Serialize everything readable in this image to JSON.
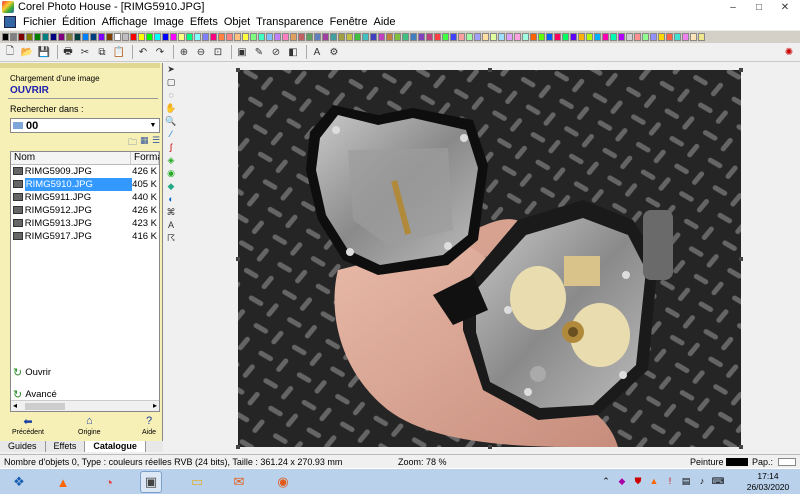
{
  "window": {
    "title": "Corel Photo House - [RIMG5910.JPG]",
    "controls": [
      "–",
      "□",
      "✕"
    ]
  },
  "menu": [
    "Fichier",
    "Édition",
    "Affichage",
    "Image",
    "Effets",
    "Objet",
    "Transparence",
    "Fenêtre",
    "Aide"
  ],
  "palette_colors": [
    "#000000",
    "#808080",
    "#800000",
    "#808000",
    "#008000",
    "#008080",
    "#000080",
    "#800080",
    "#808040",
    "#004040",
    "#0080ff",
    "#004080",
    "#8000ff",
    "#804000",
    "#ffffff",
    "#c0c0c0",
    "#ff0000",
    "#ffff00",
    "#00ff00",
    "#00ffff",
    "#0000ff",
    "#ff00ff",
    "#ffff80",
    "#00ff80",
    "#80ffff",
    "#8080ff",
    "#ff0080",
    "#ff8040",
    "#ff8080",
    "#ffc080",
    "#ffff40",
    "#80ff80",
    "#40ffc0",
    "#80c0ff",
    "#c080ff",
    "#ff80c0",
    "#e0a060",
    "#c06060",
    "#60a060",
    "#6080c0",
    "#a040a0",
    "#40a0a0",
    "#a0a040",
    "#c0c040",
    "#40c040",
    "#40c0c0",
    "#4040c0",
    "#c040c0",
    "#c08040",
    "#80c040",
    "#40c080",
    "#4080c0",
    "#8040c0",
    "#c04080",
    "#ff4040",
    "#40ff40",
    "#4040ff",
    "#ffa0a0",
    "#a0ffa0",
    "#a0a0ff",
    "#ffe0a0",
    "#e0ffa0",
    "#a0e0ff",
    "#e0a0ff",
    "#ffa0e0",
    "#a0ffe0",
    "#ff6000",
    "#60ff00",
    "#0060ff",
    "#ff0060",
    "#00ff60",
    "#6000ff",
    "#ffb000",
    "#b0ff00",
    "#00b0ff",
    "#ff00b0",
    "#00ffb0",
    "#b000ff",
    "#d0d0d0",
    "#ff9090",
    "#90ff90",
    "#9090ff",
    "#ffd700",
    "#ff6347",
    "#40e0d0",
    "#ee82ee",
    "#ffe4b5",
    "#f0e68c"
  ],
  "left_panel": {
    "subtitle": "Chargement d'une image",
    "title": "OUVRIR",
    "search_label": "Rechercher dans :",
    "folder": "00",
    "columns": [
      "Nom",
      "Forma"
    ],
    "files": [
      {
        "name": "RIMG5909.JPG",
        "size": "426 K",
        "selected": false
      },
      {
        "name": "RIMG5910.JPG",
        "size": "405 K",
        "selected": true
      },
      {
        "name": "RIMG5911.JPG",
        "size": "440 K",
        "selected": false
      },
      {
        "name": "RIMG5912.JPG",
        "size": "426 K",
        "selected": false
      },
      {
        "name": "RIMG5913.JPG",
        "size": "423 K",
        "selected": false
      },
      {
        "name": "RIMG5917.JPG",
        "size": "416 K",
        "selected": false
      }
    ],
    "actions": {
      "open": "Ouvrir",
      "advanced": "Avancé"
    },
    "nav": {
      "prev": "Précédent",
      "origin": "Origine",
      "help": "Aide"
    }
  },
  "tabs": [
    "Guides",
    "Effets",
    "Catalogue"
  ],
  "active_tab": "Catalogue",
  "status": {
    "info": "Nombre d'objets 0, Type : couleurs réelles RVB (24 bits), Taille : 361.24 x 270.93 mm",
    "zoom": "Zoom: 78 %",
    "paint_label": "Peinture :",
    "pep_label": "Pap.:"
  },
  "taskbar": {
    "time": "17:14",
    "date": "26/03/2020"
  }
}
